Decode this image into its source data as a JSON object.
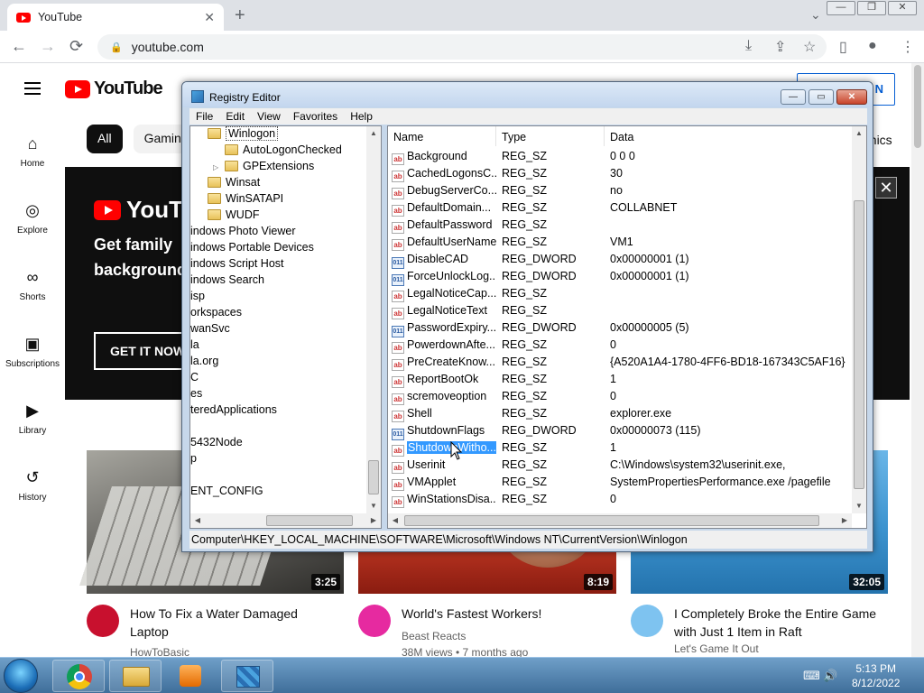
{
  "browser": {
    "tab_title": "YouTube",
    "tab_close": "✕",
    "new_tab": "+",
    "tab_list": "⌄",
    "window_buttons": [
      "—",
      "❐",
      "✕"
    ],
    "url": "youtube.com",
    "back": "←",
    "forward": "→",
    "reload": "⟳",
    "lock": "🔒",
    "toolbar_icons": [
      "⤓",
      "⇪",
      "☆",
      "▯",
      "●",
      "⋮"
    ]
  },
  "youtube": {
    "logo_text": "YouTube",
    "sign_in": "N",
    "sidebar": [
      {
        "icon": "⌂",
        "label": "Home"
      },
      {
        "icon": "◎",
        "label": "Explore"
      },
      {
        "icon": "∞",
        "label": "Shorts"
      },
      {
        "icon": "▣",
        "label": "Subscriptions"
      },
      {
        "icon": "▶",
        "label": "Library"
      },
      {
        "icon": "↺",
        "label": "History"
      }
    ],
    "chips": [
      "All",
      "Gamin"
    ],
    "chip_right": "onics",
    "banner": {
      "logo": "YouTub",
      "line1": "Get family",
      "line2": "background",
      "cta": "GET IT NOW",
      "close": "✕"
    },
    "videos": [
      {
        "title": "How To Fix a Water Damaged Laptop",
        "channel": "HowToBasic",
        "duration": "3:25",
        "meta": "",
        "avatar_color": "#c8102e",
        "avatar_text": "HOW TO BASIC"
      },
      {
        "title": "World's Fastest Workers!",
        "channel": "Beast Reacts",
        "duration": "8:19",
        "meta": "38M views • 7 months ago",
        "avatar_color": "#e62aa0",
        "avatar_text": ""
      },
      {
        "title": "I Completely Broke the Entire Game with Just 1 Item in Raft",
        "channel": "Let's Game It Out",
        "duration": "32:05",
        "meta": "",
        "avatar_color": "#7ec3f0",
        "avatar_text": "LET'S GAME IT OUT"
      }
    ]
  },
  "regedit": {
    "title": "Registry Editor",
    "window_buttons": [
      "—",
      "▭",
      "✕"
    ],
    "menu": [
      "File",
      "Edit",
      "View",
      "Favorites",
      "Help"
    ],
    "tree": [
      {
        "label": "Winlogon",
        "indent": 1,
        "folder": true,
        "selected": true,
        "expander": ""
      },
      {
        "label": "AutoLogonChecked",
        "indent": 2,
        "folder": true,
        "selected": false,
        "expander": ""
      },
      {
        "label": "GPExtensions",
        "indent": 2,
        "folder": true,
        "selected": false,
        "expander": "▷"
      },
      {
        "label": "Winsat",
        "indent": 1,
        "folder": true,
        "selected": false,
        "expander": ""
      },
      {
        "label": "WinSATAPI",
        "indent": 1,
        "folder": true,
        "selected": false,
        "expander": ""
      },
      {
        "label": "WUDF",
        "indent": 1,
        "folder": true,
        "selected": false,
        "expander": ""
      },
      {
        "label": "indows Photo Viewer",
        "indent": 0,
        "folder": false,
        "selected": false,
        "expander": ""
      },
      {
        "label": "indows Portable Devices",
        "indent": 0,
        "folder": false,
        "selected": false,
        "expander": ""
      },
      {
        "label": "indows Script Host",
        "indent": 0,
        "folder": false,
        "selected": false,
        "expander": ""
      },
      {
        "label": "indows Search",
        "indent": 0,
        "folder": false,
        "selected": false,
        "expander": ""
      },
      {
        "label": "isp",
        "indent": 0,
        "folder": false,
        "selected": false,
        "expander": ""
      },
      {
        "label": "orkspaces",
        "indent": 0,
        "folder": false,
        "selected": false,
        "expander": ""
      },
      {
        "label": "wanSvc",
        "indent": 0,
        "folder": false,
        "selected": false,
        "expander": ""
      },
      {
        "label": "la",
        "indent": 0,
        "folder": false,
        "selected": false,
        "expander": ""
      },
      {
        "label": "la.org",
        "indent": 0,
        "folder": false,
        "selected": false,
        "expander": ""
      },
      {
        "label": "C",
        "indent": 0,
        "folder": false,
        "selected": false,
        "expander": ""
      },
      {
        "label": "es",
        "indent": 0,
        "folder": false,
        "selected": false,
        "expander": ""
      },
      {
        "label": "teredApplications",
        "indent": 0,
        "folder": false,
        "selected": false,
        "expander": ""
      },
      {
        "label": "",
        "indent": 0,
        "folder": false,
        "selected": false,
        "expander": ""
      },
      {
        "label": "5432Node",
        "indent": 0,
        "folder": false,
        "selected": false,
        "expander": ""
      },
      {
        "label": "p",
        "indent": 0,
        "folder": false,
        "selected": false,
        "expander": ""
      },
      {
        "label": "",
        "indent": 0,
        "folder": false,
        "selected": false,
        "expander": ""
      },
      {
        "label": "ENT_CONFIG",
        "indent": 0,
        "folder": false,
        "selected": false,
        "expander": ""
      }
    ],
    "columns": [
      "Name",
      "Type",
      "Data"
    ],
    "values": [
      {
        "name": "Background",
        "type": "REG_SZ",
        "data": "0 0 0",
        "kind": "sz"
      },
      {
        "name": "CachedLogonsC...",
        "type": "REG_SZ",
        "data": "30",
        "kind": "sz"
      },
      {
        "name": "DebugServerCo...",
        "type": "REG_SZ",
        "data": "no",
        "kind": "sz"
      },
      {
        "name": "DefaultDomain...",
        "type": "REG_SZ",
        "data": "COLLABNET",
        "kind": "sz"
      },
      {
        "name": "DefaultPassword",
        "type": "REG_SZ",
        "data": "",
        "kind": "sz"
      },
      {
        "name": "DefaultUserName",
        "type": "REG_SZ",
        "data": "VM1",
        "kind": "sz"
      },
      {
        "name": "DisableCAD",
        "type": "REG_DWORD",
        "data": "0x00000001 (1)",
        "kind": "dw"
      },
      {
        "name": "ForceUnlockLog...",
        "type": "REG_DWORD",
        "data": "0x00000001 (1)",
        "kind": "dw"
      },
      {
        "name": "LegalNoticeCap...",
        "type": "REG_SZ",
        "data": "",
        "kind": "sz"
      },
      {
        "name": "LegalNoticeText",
        "type": "REG_SZ",
        "data": "",
        "kind": "sz"
      },
      {
        "name": "PasswordExpiry...",
        "type": "REG_DWORD",
        "data": "0x00000005 (5)",
        "kind": "dw"
      },
      {
        "name": "PowerdownAfte...",
        "type": "REG_SZ",
        "data": "0",
        "kind": "sz"
      },
      {
        "name": "PreCreateKnow...",
        "type": "REG_SZ",
        "data": "{A520A1A4-1780-4FF6-BD18-167343C5AF16}",
        "kind": "sz"
      },
      {
        "name": "ReportBootOk",
        "type": "REG_SZ",
        "data": "1",
        "kind": "sz"
      },
      {
        "name": "scremoveoption",
        "type": "REG_SZ",
        "data": "0",
        "kind": "sz"
      },
      {
        "name": "Shell",
        "type": "REG_SZ",
        "data": "explorer.exe",
        "kind": "sz"
      },
      {
        "name": "ShutdownFlags",
        "type": "REG_DWORD",
        "data": "0x00000073 (115)",
        "kind": "dw"
      },
      {
        "name": "ShutdownWitho...",
        "type": "REG_SZ",
        "data": "1",
        "kind": "sz",
        "selected": true
      },
      {
        "name": "Userinit",
        "type": "REG_SZ",
        "data": "C:\\Windows\\system32\\userinit.exe,",
        "kind": "sz"
      },
      {
        "name": "VMApplet",
        "type": "REG_SZ",
        "data": "SystemPropertiesPerformance.exe /pagefile",
        "kind": "sz"
      },
      {
        "name": "WinStationsDisa...",
        "type": "REG_SZ",
        "data": "0",
        "kind": "sz"
      }
    ],
    "sz_icon": "ab",
    "dw_icon": "011",
    "status_path": "Computer\\HKEY_LOCAL_MACHINE\\SOFTWARE\\Microsoft\\Windows NT\\CurrentVersion\\Winlogon"
  },
  "taskbar": {
    "time": "5:13 PM",
    "date": "8/12/2022",
    "tray": "⌨ 🔊"
  }
}
